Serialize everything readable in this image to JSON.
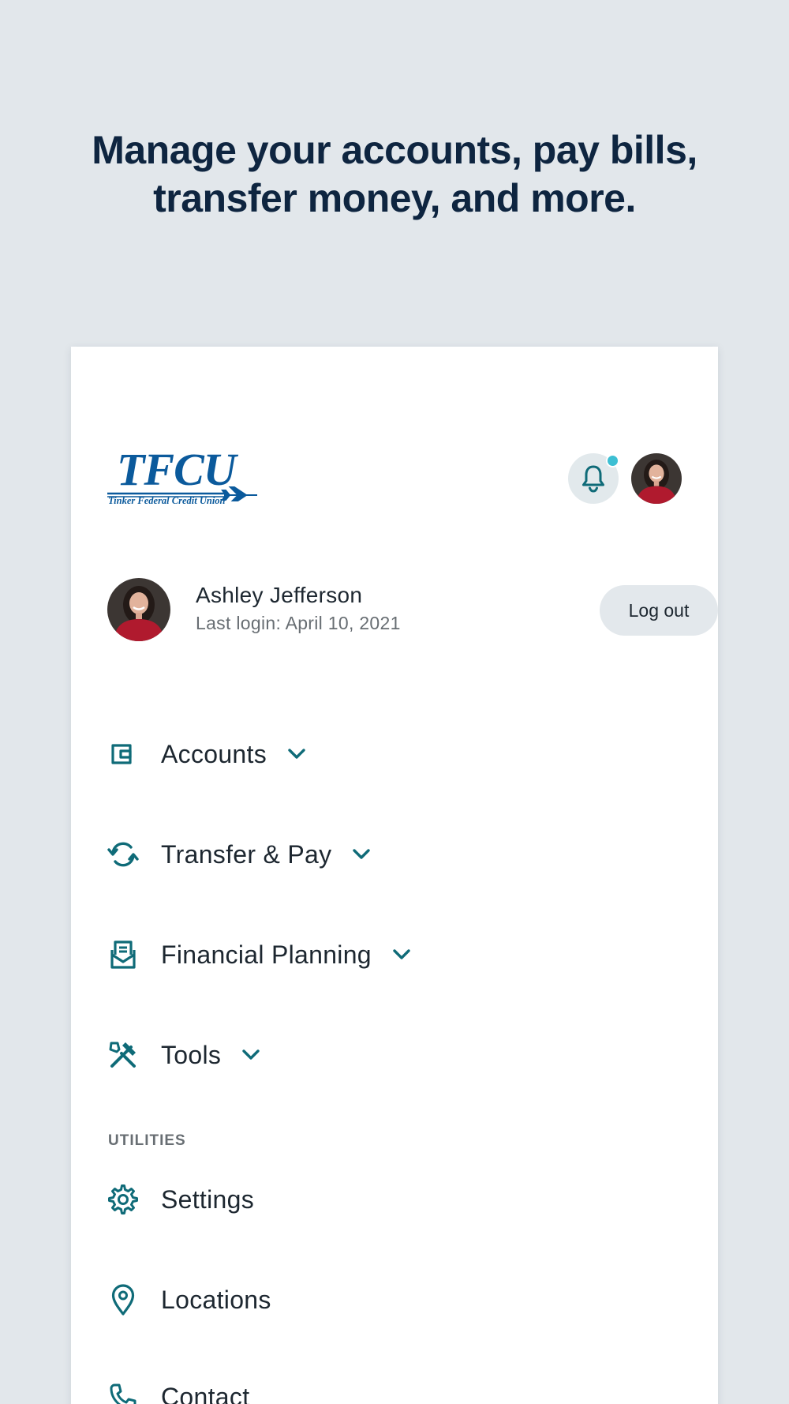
{
  "headline": {
    "line1": "Manage your accounts, pay bills,",
    "line2": "transfer money, and more."
  },
  "brand": {
    "logo_text": "TFCU",
    "logo_subtitle": "Tinker Federal Credit Union",
    "logo_color": "#0b5a9c"
  },
  "header": {
    "notification_icon": "bell-icon",
    "notification_badge_color": "#3dbfd3"
  },
  "profile": {
    "name": "Ashley Jefferson",
    "last_login": "Last login: April 10, 2021",
    "logout_label": "Log out"
  },
  "nav": {
    "items": [
      {
        "label": "Accounts",
        "icon": "wallet-icon",
        "expandable": true
      },
      {
        "label": "Transfer & Pay",
        "icon": "transfer-icon",
        "expandable": true
      },
      {
        "label": "Financial Planning",
        "icon": "inbox-icon",
        "expandable": true
      },
      {
        "label": "Tools",
        "icon": "tools-icon",
        "expandable": true
      }
    ]
  },
  "utilities": {
    "heading": "UTILITIES",
    "items": [
      {
        "label": "Settings",
        "icon": "gear-icon"
      },
      {
        "label": "Locations",
        "icon": "map-pin-icon"
      },
      {
        "label": "Contact",
        "icon": "phone-icon"
      }
    ]
  },
  "colors": {
    "page_background": "#e2e7eb",
    "headline": "#0e2540",
    "accent": "#0f6b78",
    "text": "#1d2730",
    "muted": "#686e73"
  }
}
